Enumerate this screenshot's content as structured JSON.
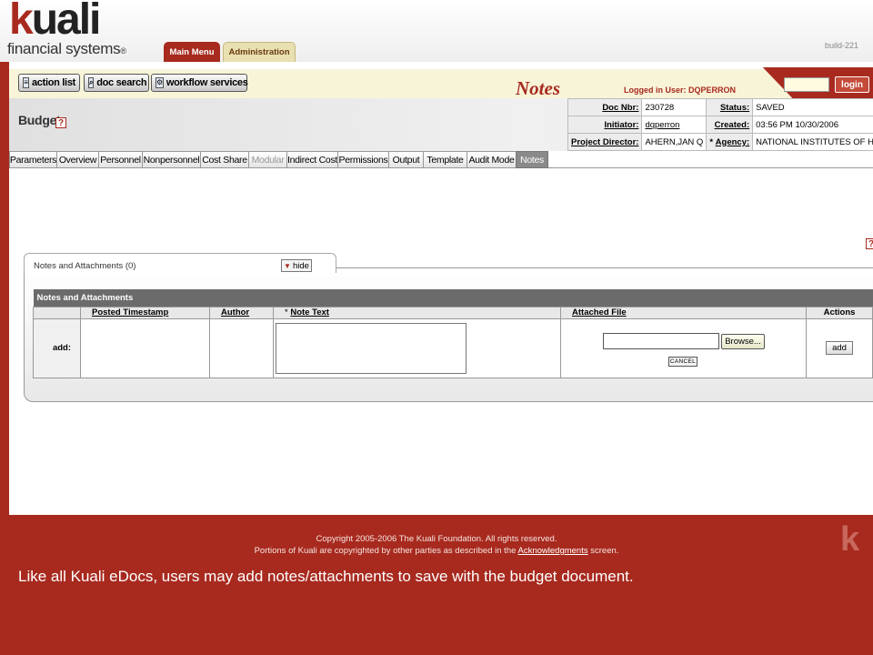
{
  "header": {
    "logo_text_k": "k",
    "logo_text_rest": "uali",
    "logo_subtitle": "financial systems",
    "logo_registered": "®",
    "build": "build-221",
    "tabs": [
      {
        "label": "Main Menu",
        "active": true
      },
      {
        "label": "Administration",
        "active": false
      }
    ]
  },
  "toolbar": {
    "action_list": "action list",
    "doc_search": "doc search",
    "workflow_services": "workflow services",
    "page_title": "Notes",
    "logged_in": "Logged in User: DQPERRON",
    "login_button": "login"
  },
  "document": {
    "name": "Budget",
    "help_icon": "?",
    "info": {
      "doc_nbr_label": "Doc Nbr:",
      "doc_nbr": "230728",
      "status_label": "Status:",
      "status": "SAVED",
      "initiator_label": "Initiator:",
      "initiator": "dqperron",
      "created_label": "Created:",
      "created": "03:56 PM 10/30/2006",
      "project_director_label": "Project Director:",
      "project_director": "AHERN,JAN Q",
      "agency_label": "Agency:",
      "agency_required": "* ",
      "agency": "NATIONAL INSTITUTES OF HEALTH"
    }
  },
  "tabs": [
    {
      "label": "Parameters",
      "state": "normal"
    },
    {
      "label": "Overview",
      "state": "normal"
    },
    {
      "label": "Personnel",
      "state": "normal"
    },
    {
      "label": "Nonpersonnel",
      "state": "normal"
    },
    {
      "label": "Cost Share",
      "state": "normal"
    },
    {
      "label": "Modular",
      "state": "disabled"
    },
    {
      "label": "Indirect Cost",
      "state": "normal"
    },
    {
      "label": "Permissions",
      "state": "normal"
    },
    {
      "label": "Output",
      "state": "normal"
    },
    {
      "label": "Template",
      "state": "normal"
    },
    {
      "label": "Audit Mode",
      "state": "normal"
    },
    {
      "label": "Notes",
      "state": "active"
    }
  ],
  "notes_panel": {
    "tab_label": "Notes and Attachments (0)",
    "hide_button": "hide",
    "hide_arrow": "▼",
    "section_title": "Notes and Attachments",
    "columns": {
      "posted_timestamp": "Posted Timestamp",
      "author": "Author",
      "note_text_required": "* ",
      "note_text": "Note Text",
      "attached_file": "Attached File",
      "actions": "Actions"
    },
    "add_row_label": "add:",
    "browse_button": "Browse...",
    "cancel_button": "CANCEL",
    "add_button": "add"
  },
  "footer": {
    "copyright_line1": "Copyright 2005-2006 The Kuali Foundation. All rights reserved.",
    "copyright_line2_pre": "Portions of Kuali are copyrighted by other parties as described in the ",
    "copyright_link": "Acknowledgments",
    "copyright_line2_post": " screen.",
    "footer_logo": "k",
    "caption": "Like all Kuali eDocs, users may add notes/attachments to save with the budget document."
  },
  "colors": {
    "brand_red": "#a82a1f",
    "toolbar_bg": "#f8f4d8",
    "active_tab": "#8a8a8a"
  }
}
